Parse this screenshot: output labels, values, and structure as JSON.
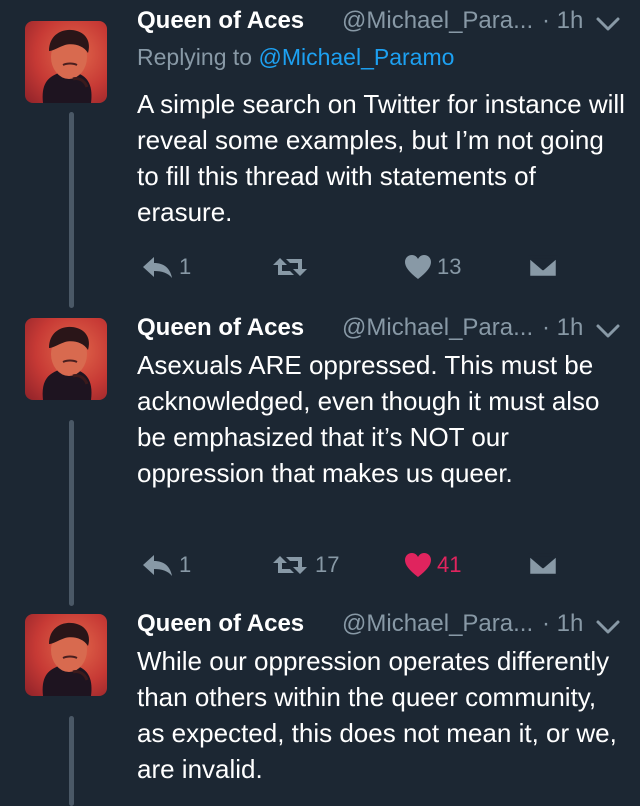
{
  "colors": {
    "background": "#1c2733",
    "secondary_text": "#8899a6",
    "link": "#1da1f2",
    "like_active": "#e0245e",
    "thread_line": "#4a5866"
  },
  "tweets": [
    {
      "author_name": "Queen of Aces",
      "handle": "@Michael_Para...",
      "time": "· 1h",
      "replying_prefix": "Replying to",
      "replying_to": "@Michael_Paramo",
      "text": "A simple search on Twitter for instance will reveal some examples, but I’m not going to fill this thread with statements of erasure.",
      "replies": "1",
      "retweets": "",
      "likes": "13",
      "liked": false
    },
    {
      "author_name": "Queen of Aces",
      "handle": "@Michael_Para...",
      "time": "· 1h",
      "text": "Asexuals ARE oppressed. This must be acknowledged, even though it must also be emphasized that it’s NOT our oppression that makes us queer.",
      "replies": "1",
      "retweets": "17",
      "likes": "41",
      "liked": true
    },
    {
      "author_name": "Queen of Aces",
      "handle": "@Michael_Para...",
      "time": "· 1h",
      "text": "While our oppression operates differently than others within the queer community, as expected, this does not mean it, or we, are invalid."
    }
  ]
}
